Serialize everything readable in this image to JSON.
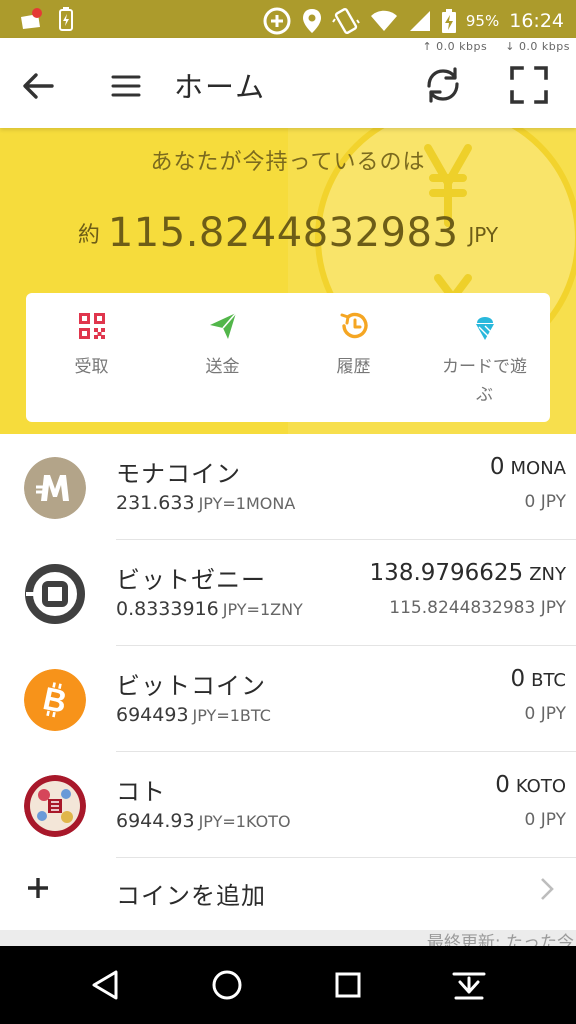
{
  "status_bar": {
    "battery_percent": "95%",
    "time": "16:24",
    "icons": [
      "notification-icon",
      "battery-saver-icon",
      "data-saver-icon",
      "location-icon",
      "vibrate-icon",
      "wifi-icon",
      "signal-icon",
      "battery-charging-icon"
    ]
  },
  "net_speed": {
    "up": "0.0 kbps",
    "down": "0.0 kbps"
  },
  "app_bar": {
    "title": "ホーム",
    "icons": [
      "back-arrow-icon",
      "menu-icon",
      "refresh-icon",
      "qr-scan-icon"
    ]
  },
  "hero": {
    "caption": "あなたが今持っているのは",
    "approx_label": "約",
    "total_value": "115.8244832983",
    "currency": "JPY"
  },
  "actions": [
    {
      "label": "受取",
      "icon": "qr-code-icon",
      "color": "#e0364d"
    },
    {
      "label": "送金",
      "icon": "send-icon",
      "color": "#52b64a"
    },
    {
      "label": "履歴",
      "icon": "history-icon",
      "color": "#f5a623"
    },
    {
      "label": "カードで遊ぶ",
      "icon": "ice-cream-icon",
      "color": "#29b8dc"
    }
  ],
  "coins": [
    {
      "name": "モナコイン",
      "rate_value": "231.633",
      "rate_unit": "JPY=1MONA",
      "balance": "0",
      "symbol": "MONA",
      "jpy_value": "0 JPY",
      "logo": "monacoin-logo"
    },
    {
      "name": "ビットゼニー",
      "rate_value": "0.8333916",
      "rate_unit": "JPY=1ZNY",
      "balance": "138.9796625",
      "symbol": "ZNY",
      "jpy_value": "115.8244832983 JPY",
      "logo": "bitzeny-logo"
    },
    {
      "name": "ビットコイン",
      "rate_value": "694493",
      "rate_unit": "JPY=1BTC",
      "balance": "0",
      "symbol": "BTC",
      "jpy_value": "0 JPY",
      "logo": "bitcoin-logo"
    },
    {
      "name": "コト",
      "rate_value": "6944.93",
      "rate_unit": "JPY=1KOTO",
      "balance": "0",
      "symbol": "KOTO",
      "jpy_value": "0 JPY",
      "logo": "koto-logo"
    }
  ],
  "add_coin": {
    "label": "コインを追加"
  },
  "last_updated": "最終更新: たった今",
  "nav_bar": {
    "icons": [
      "back-triangle-icon",
      "home-circle-icon",
      "recents-square-icon",
      "notification-pull-icon"
    ]
  },
  "colors": {
    "status_bar": "#ac9b2c",
    "hero": "#f6dc3c",
    "hero_text": "#7b6a1e"
  }
}
